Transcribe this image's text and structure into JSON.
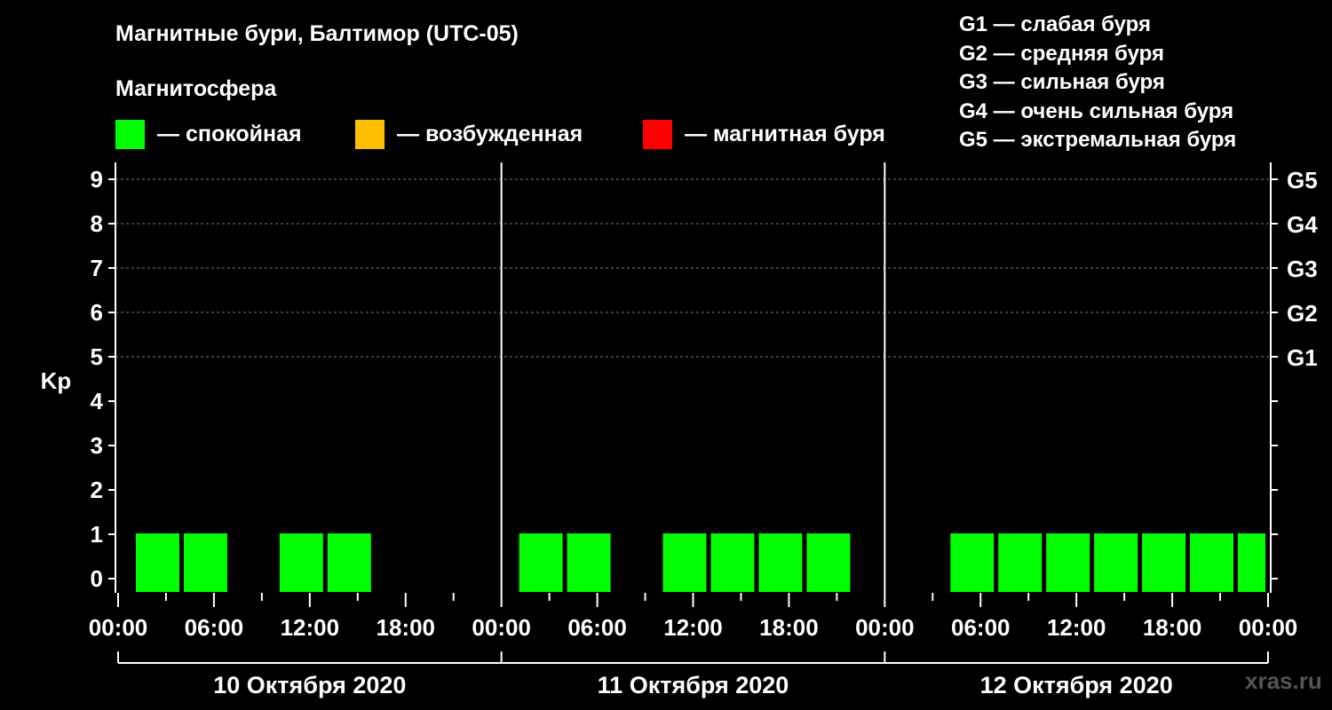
{
  "title": "Магнитные бури, Балтимор (UTC-05)",
  "subtitle": "Магнитосфера",
  "legend": [
    {
      "label": "— спокойная",
      "color": "#00ff00"
    },
    {
      "label": "— возбужденная",
      "color": "#ffbf00"
    },
    {
      "label": "— магнитная буря",
      "color": "#ff0000"
    }
  ],
  "g_legend": [
    "G1 — слабая буря",
    "G2 — средняя буря",
    "G3 — сильная буря",
    "G4 — очень сильная буря",
    "G5 — экстремальная буря"
  ],
  "watermark": "xras.ru",
  "chart_data": {
    "type": "bar",
    "ylabel": "Kp",
    "ylim": [
      0,
      9
    ],
    "yticks": [
      "0",
      "1",
      "2",
      "3",
      "4",
      "5",
      "6",
      "7",
      "8",
      "9"
    ],
    "right_ticks": [
      {
        "value": 5,
        "label": "G1"
      },
      {
        "value": 6,
        "label": "G2"
      },
      {
        "value": 7,
        "label": "G3"
      },
      {
        "value": 8,
        "label": "G4"
      },
      {
        "value": 9,
        "label": "G5"
      }
    ],
    "xtick_labels": [
      "00:00",
      "06:00",
      "12:00",
      "18:00",
      "00:00",
      "06:00",
      "12:00",
      "18:00",
      "00:00",
      "06:00",
      "12:00",
      "18:00",
      "00:00"
    ],
    "days": [
      "10 Октября 2020",
      "11 Октября 2020",
      "12 Октября 2020"
    ],
    "grid": true,
    "color": "#00ff00",
    "bars": [
      {
        "start_hour": 1,
        "end_hour": 4,
        "kp": 1
      },
      {
        "start_hour": 4,
        "end_hour": 7,
        "kp": 1
      },
      {
        "start_hour": 10,
        "end_hour": 13,
        "kp": 1
      },
      {
        "start_hour": 13,
        "end_hour": 16,
        "kp": 1
      },
      {
        "start_hour": 25,
        "end_hour": 28,
        "kp": 1
      },
      {
        "start_hour": 28,
        "end_hour": 31,
        "kp": 1
      },
      {
        "start_hour": 34,
        "end_hour": 37,
        "kp": 1
      },
      {
        "start_hour": 37,
        "end_hour": 40,
        "kp": 1
      },
      {
        "start_hour": 40,
        "end_hour": 43,
        "kp": 1
      },
      {
        "start_hour": 43,
        "end_hour": 46,
        "kp": 1
      },
      {
        "start_hour": 52,
        "end_hour": 55,
        "kp": 1
      },
      {
        "start_hour": 55,
        "end_hour": 58,
        "kp": 1
      },
      {
        "start_hour": 58,
        "end_hour": 61,
        "kp": 1
      },
      {
        "start_hour": 61,
        "end_hour": 64,
        "kp": 1
      },
      {
        "start_hour": 64,
        "end_hour": 67,
        "kp": 1
      },
      {
        "start_hour": 67,
        "end_hour": 70,
        "kp": 1
      },
      {
        "start_hour": 70,
        "end_hour": 72,
        "kp": 1
      }
    ]
  }
}
